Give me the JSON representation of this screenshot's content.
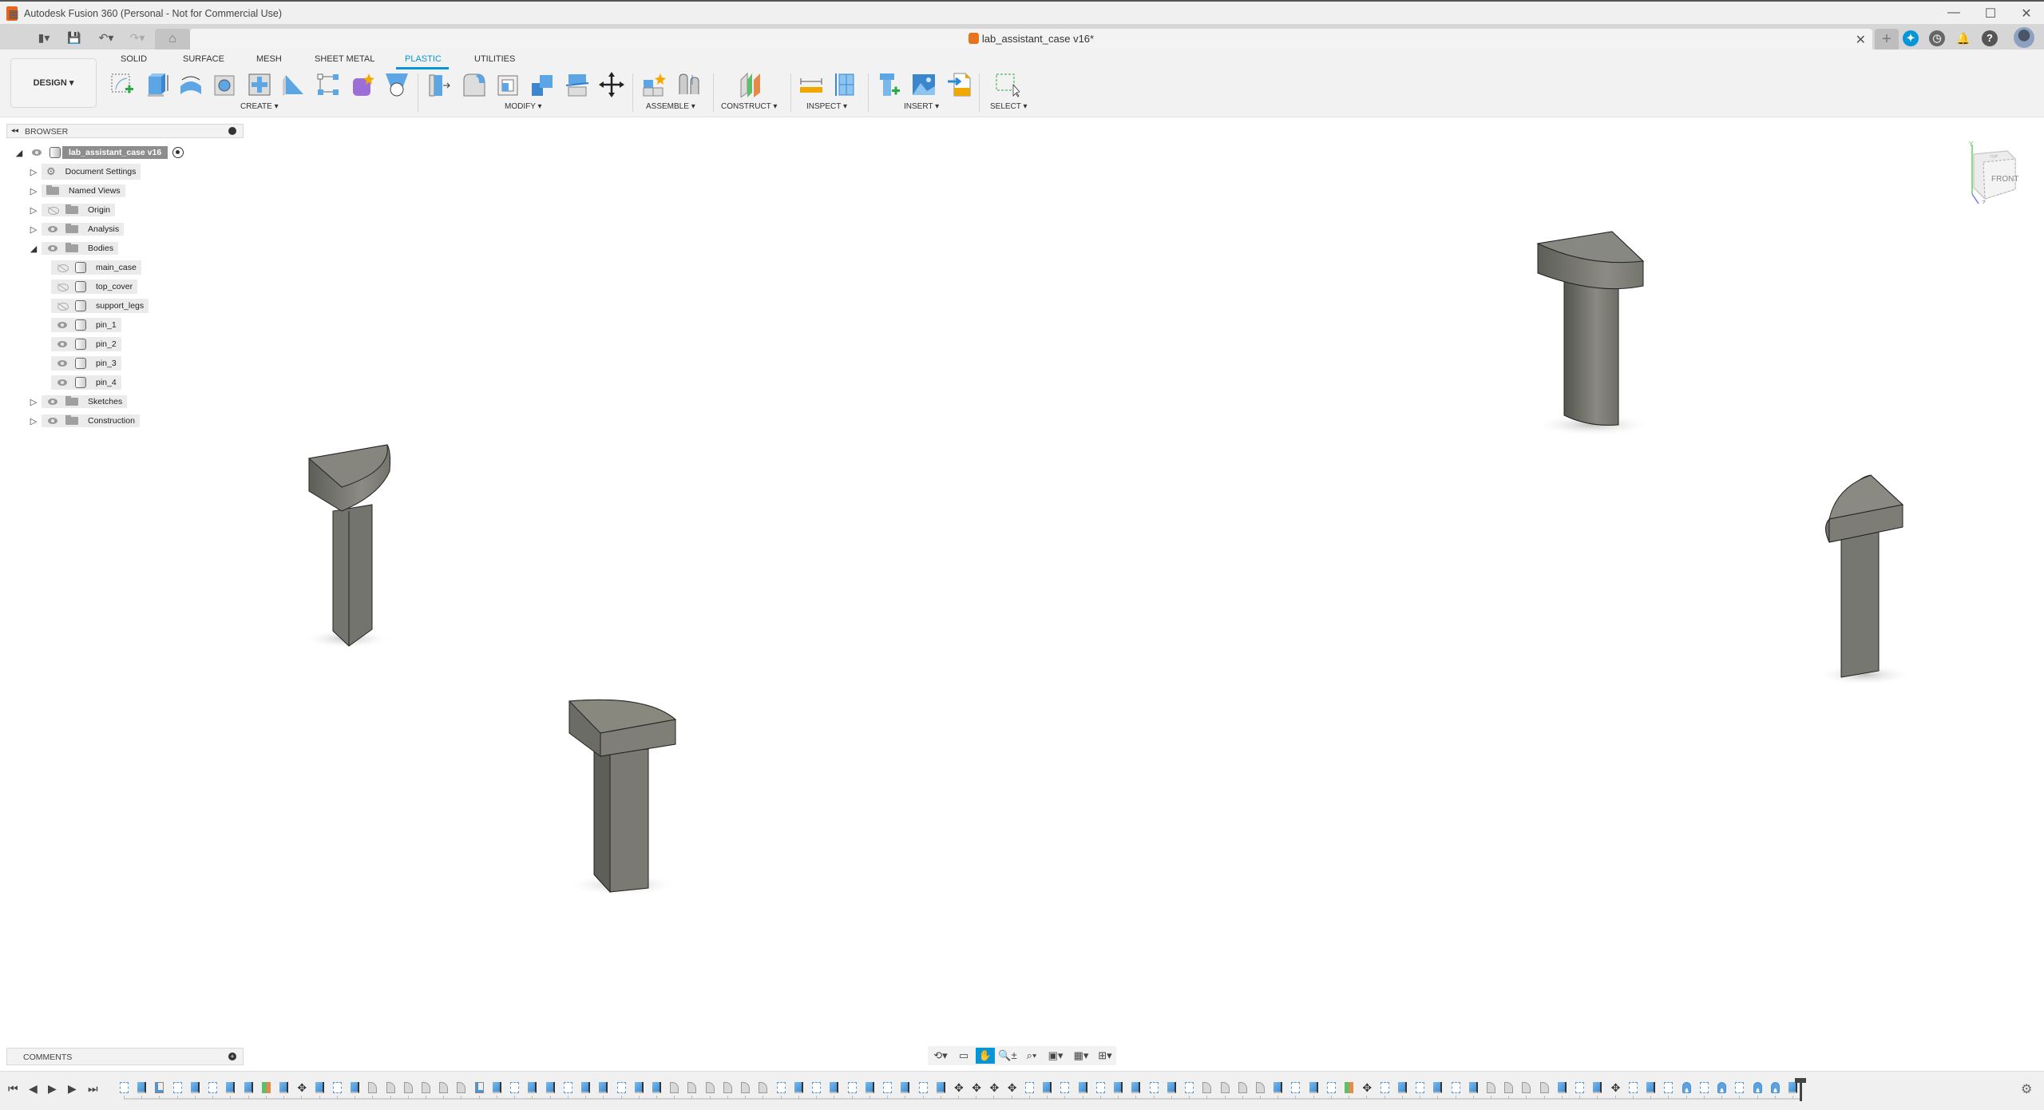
{
  "window": {
    "title": "Autodesk Fusion 360 (Personal - Not for Commercial Use)",
    "controls": {
      "minimize": "—",
      "maximize": "☐",
      "close": "✕"
    }
  },
  "quick_toolbar": {
    "apps_icon": "▦",
    "file_icon": "▮▾",
    "save_icon": "💾",
    "undo_icon": "↶▾",
    "redo_icon": "↷▾",
    "home_icon": "⌂"
  },
  "document_tab": {
    "title": "lab_assistant_case v16*",
    "close": "✕",
    "new_tab": "+"
  },
  "header_icons": [
    "extensions-icon",
    "job-status-icon",
    "notifications-icon",
    "help-icon",
    "profile-avatar"
  ],
  "header_glyphs": {
    "extensions": "✦",
    "job_status": "◷",
    "notifications": "🔔",
    "help": "?",
    "profile": "●"
  },
  "ribbon": {
    "workspace": "DESIGN ▾",
    "tabs": [
      {
        "label": "SOLID",
        "active": false
      },
      {
        "label": "SURFACE",
        "active": false
      },
      {
        "label": "MESH",
        "active": false
      },
      {
        "label": "SHEET METAL",
        "active": false
      },
      {
        "label": "PLASTIC",
        "active": true
      },
      {
        "label": "UTILITIES",
        "active": false
      }
    ],
    "groups": [
      {
        "label": "CREATE ▾",
        "tools": [
          "create-sketch",
          "extrude",
          "revolve",
          "boss",
          "rib-web",
          "web",
          "snap-fit",
          "create-form",
          "loft"
        ]
      },
      {
        "label": "MODIFY ▾",
        "tools": [
          "press-pull",
          "fillet",
          "shell",
          "combine",
          "split-body",
          "move-copy"
        ]
      },
      {
        "label": "ASSEMBLE ▾",
        "tools": [
          "new-component",
          "joint"
        ]
      },
      {
        "label": "CONSTRUCT ▾",
        "tools": [
          "offset-plane"
        ]
      },
      {
        "label": "INSPECT ▾",
        "tools": [
          "measure",
          "section-analysis"
        ]
      },
      {
        "label": "INSERT ▾",
        "tools": [
          "insert-fastener",
          "canvas",
          "insert-svg"
        ]
      },
      {
        "label": "SELECT ▾",
        "tools": [
          "select"
        ]
      }
    ]
  },
  "browser": {
    "title": "BROWSER",
    "collapse": "◂◂",
    "root": {
      "label": "lab_assistant_case v16",
      "visible": true
    },
    "items": [
      {
        "label": "Document Settings",
        "icon": "gear",
        "eye": null,
        "level": 1,
        "expanded": false
      },
      {
        "label": "Named Views",
        "icon": "folder",
        "eye": null,
        "level": 1,
        "expanded": false
      },
      {
        "label": "Origin",
        "icon": "folder",
        "eye": "hidden",
        "level": 1,
        "expanded": false
      },
      {
        "label": "Analysis",
        "icon": "folder",
        "eye": "visible",
        "level": 1,
        "expanded": false
      },
      {
        "label": "Bodies",
        "icon": "folder",
        "eye": "visible",
        "level": 1,
        "expanded": true
      },
      {
        "label": "main_case",
        "icon": "body",
        "eye": "hidden",
        "level": 2
      },
      {
        "label": "top_cover",
        "icon": "body",
        "eye": "hidden",
        "level": 2
      },
      {
        "label": "support_legs",
        "icon": "body",
        "eye": "hidden",
        "level": 2
      },
      {
        "label": "pin_1",
        "icon": "body",
        "eye": "visible",
        "level": 2
      },
      {
        "label": "pin_2",
        "icon": "body",
        "eye": "visible",
        "level": 2
      },
      {
        "label": "pin_3",
        "icon": "body",
        "eye": "visible",
        "level": 2
      },
      {
        "label": "pin_4",
        "icon": "body",
        "eye": "visible",
        "level": 2
      },
      {
        "label": "Sketches",
        "icon": "folder",
        "eye": "visible",
        "level": 1,
        "expanded": false
      },
      {
        "label": "Construction",
        "icon": "folder",
        "eye": "visible",
        "level": 1,
        "expanded": false
      }
    ]
  },
  "viewcube": {
    "face": "FRONT",
    "top": "TOP",
    "axis_y": "Y",
    "axis_z": "Z"
  },
  "comments": {
    "title": "COMMENTS",
    "add": "+"
  },
  "navbar": {
    "orbit": "⟲▾",
    "look_at": "▭",
    "pan": "✋",
    "zoom": "🔍±",
    "fit": "⌕▾",
    "display": "▣▾",
    "grid": "▦▾",
    "viewports": "⊞▾"
  },
  "timeline": {
    "controls": [
      "⏮",
      "◀",
      "▶",
      "▶",
      "⏭"
    ],
    "features": [
      "sk",
      "ext",
      "shl",
      "sk",
      "ext",
      "sk",
      "ext",
      "ext",
      "pln",
      "spl",
      "mov",
      "ext",
      "sk",
      "ext",
      "fil",
      "fil",
      "fil",
      "fil",
      "fil",
      "fil",
      "shl",
      "ext",
      "sk",
      "ext",
      "ext",
      "sk",
      "ext",
      "ext",
      "sk",
      "ext",
      "ext",
      "fil",
      "fil",
      "fil",
      "fil",
      "fil",
      "fil",
      "sk",
      "ext",
      "sk",
      "ext",
      "sk",
      "ext",
      "sk",
      "ext",
      "sk",
      "ext",
      "mov",
      "mov",
      "mov",
      "mov",
      "sk",
      "ext",
      "sk",
      "ext",
      "sk",
      "ext",
      "ext",
      "sk",
      "ext",
      "sk",
      "fil",
      "fil",
      "fil",
      "fil",
      "ext",
      "sk",
      "ext",
      "sk",
      "pln",
      "mov",
      "sk",
      "ext",
      "sk",
      "ext",
      "sk",
      "ext",
      "fil",
      "fil",
      "fil",
      "fil",
      "ext",
      "sk",
      "ext",
      "mov",
      "sk",
      "ext",
      "sk",
      "rev",
      "sk",
      "rev",
      "sk",
      "rev",
      "rev",
      "ext"
    ],
    "settings": "⚙"
  }
}
